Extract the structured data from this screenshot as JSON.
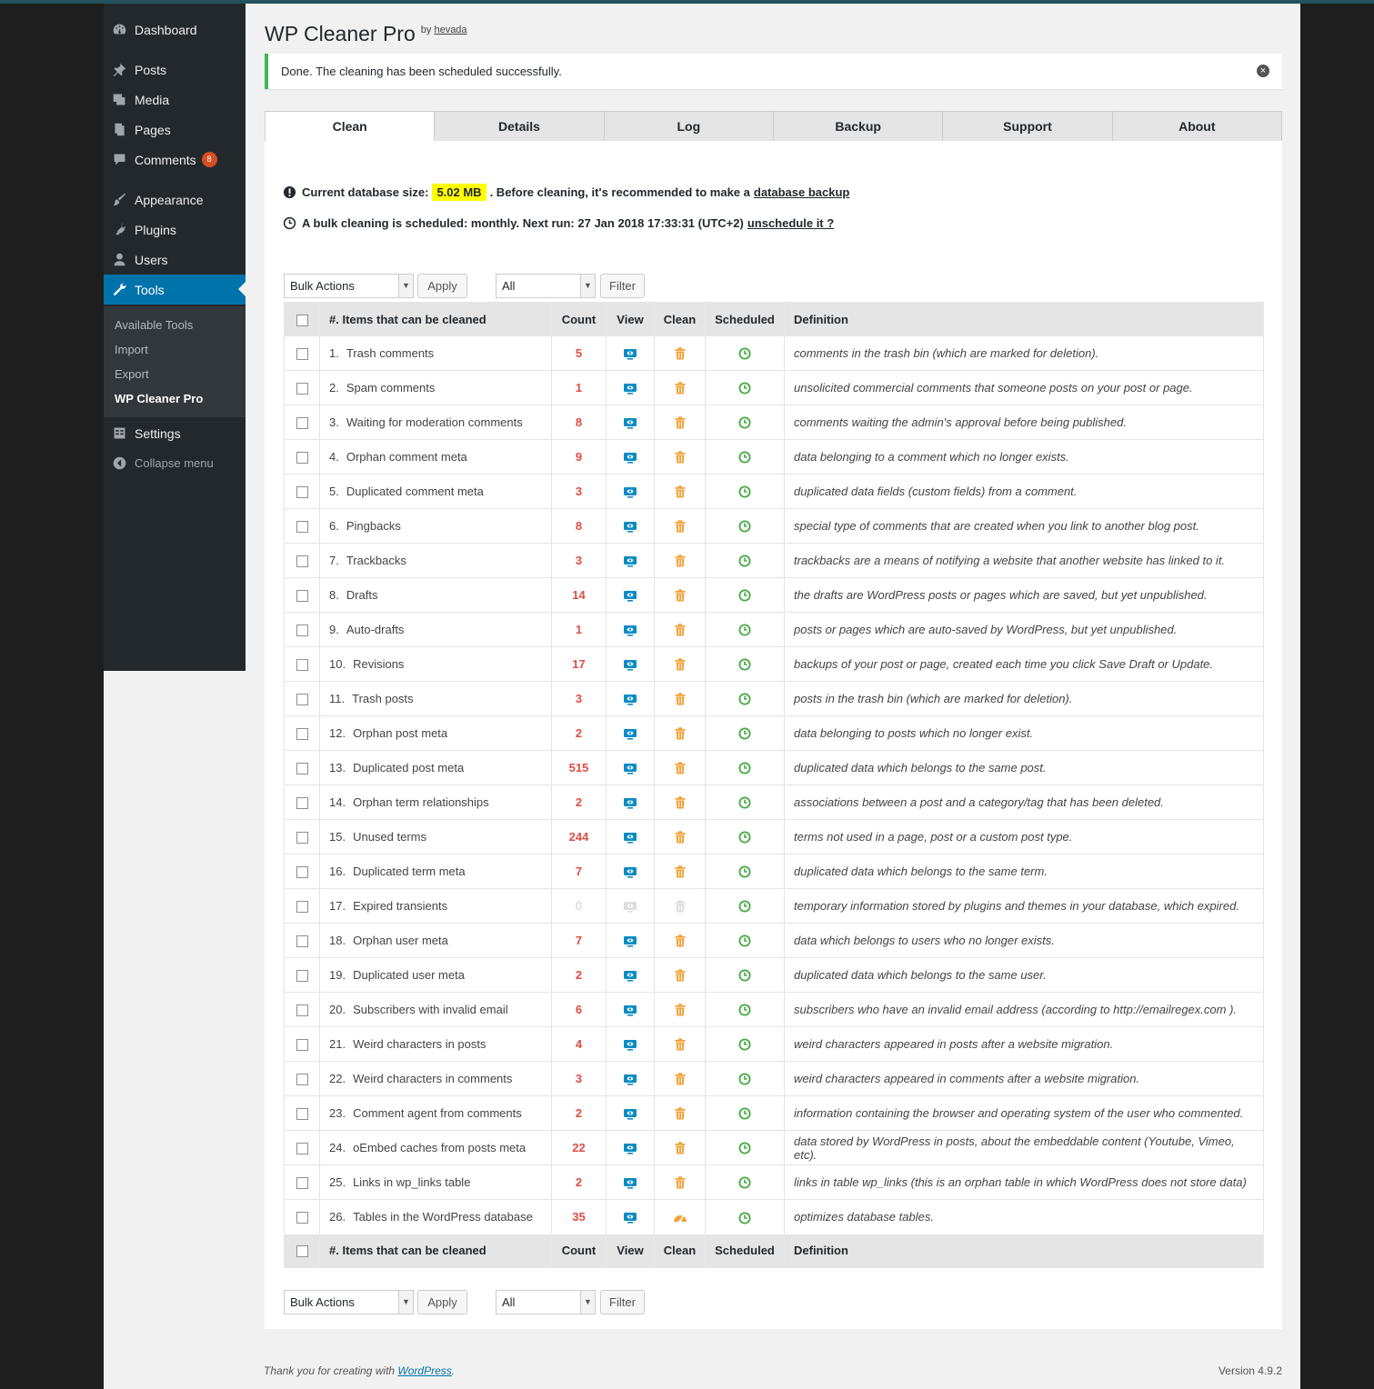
{
  "colors": {
    "sidebar_bg": "#23282d",
    "active_bg": "#0073aa",
    "notice_border": "#46b450",
    "count_red": "#e14d43",
    "view_blue": "#0c8cc4",
    "clean_orange": "#f3a33a",
    "scheduled_green": "#46a846",
    "highlight": "#ffff00"
  },
  "sidebar": {
    "items": [
      {
        "label": "Dashboard",
        "icon": "dashboard-icon"
      },
      {
        "label": "Posts",
        "icon": "pushpin-icon"
      },
      {
        "label": "Media",
        "icon": "media-icon"
      },
      {
        "label": "Pages",
        "icon": "pages-icon"
      },
      {
        "label": "Comments",
        "icon": "comment-icon",
        "badge": "8"
      },
      {
        "label": "Appearance",
        "icon": "paintbrush-icon"
      },
      {
        "label": "Plugins",
        "icon": "plugin-icon"
      },
      {
        "label": "Users",
        "icon": "user-icon"
      },
      {
        "label": "Tools",
        "icon": "wrench-icon",
        "active": true
      },
      {
        "label": "Settings",
        "icon": "settings-icon"
      },
      {
        "label": "Collapse menu",
        "icon": "collapse-icon"
      }
    ],
    "submenu": [
      "Available Tools",
      "Import",
      "Export",
      "WP Cleaner Pro"
    ]
  },
  "page": {
    "title": "WP Cleaner Pro",
    "by": "by",
    "author": "hevada"
  },
  "notice": {
    "text": "Done. The cleaning has been scheduled successfully."
  },
  "tabs": [
    "Clean",
    "Details",
    "Log",
    "Backup",
    "Support",
    "About"
  ],
  "info": {
    "db_size_label": "Current database size:",
    "db_size": "5.02 MB",
    "db_advice": ". Before cleaning, it's recommended to make a",
    "db_backup_link": "database backup",
    "schedule_text": "A bulk cleaning is scheduled: monthly. Next run: 27 Jan 2018 17:33:31 (UTC+2)",
    "unschedule_link": "unschedule it ?"
  },
  "controls": {
    "bulk_actions": "Bulk Actions",
    "apply": "Apply",
    "filter_value": "All",
    "filter": "Filter"
  },
  "table": {
    "headers": [
      "#. Items that can be cleaned",
      "Count",
      "View",
      "Clean",
      "Scheduled",
      "Definition"
    ],
    "rows": [
      {
        "n": "1.",
        "name": "Trash comments",
        "count": "5",
        "def": "comments in the trash bin (which are marked for deletion)."
      },
      {
        "n": "2.",
        "name": "Spam comments",
        "count": "1",
        "def": "unsolicited commercial comments that someone posts on your post or page."
      },
      {
        "n": "3.",
        "name": "Waiting for moderation comments",
        "count": "8",
        "def": "comments waiting the admin's approval before being published."
      },
      {
        "n": "4.",
        "name": "Orphan comment meta",
        "count": "9",
        "def": "data belonging to a comment which no longer exists."
      },
      {
        "n": "5.",
        "name": "Duplicated comment meta",
        "count": "3",
        "def": "duplicated data fields (custom fields) from a comment."
      },
      {
        "n": "6.",
        "name": "Pingbacks",
        "count": "8",
        "def": "special type of comments that are created when you link to another blog post."
      },
      {
        "n": "7.",
        "name": "Trackbacks",
        "count": "3",
        "def": "trackbacks are a means of notifying a website that another website has linked to it."
      },
      {
        "n": "8.",
        "name": "Drafts",
        "count": "14",
        "def": "the drafts are WordPress posts or pages which are saved, but yet unpublished."
      },
      {
        "n": "9.",
        "name": "Auto-drafts",
        "count": "1",
        "def": "posts or pages which are auto-saved by WordPress, but yet unpublished."
      },
      {
        "n": "10.",
        "name": "Revisions",
        "count": "17",
        "def": "backups of your post or page, created each time you click Save Draft or Update."
      },
      {
        "n": "11.",
        "name": "Trash posts",
        "count": "3",
        "def": "posts in the trash bin (which are marked for deletion)."
      },
      {
        "n": "12.",
        "name": "Orphan post meta",
        "count": "2",
        "def": "data belonging to posts which no longer exist."
      },
      {
        "n": "13.",
        "name": "Duplicated post meta",
        "count": "515",
        "def": "duplicated data which belongs to the same post."
      },
      {
        "n": "14.",
        "name": "Orphan term relationships",
        "count": "2",
        "def": "associations between a post and a category/tag that has been deleted."
      },
      {
        "n": "15.",
        "name": "Unused terms",
        "count": "244",
        "def": "terms not used in a page, post or a custom post type."
      },
      {
        "n": "16.",
        "name": "Duplicated term meta",
        "count": "7",
        "def": "duplicated data which belongs to the same term."
      },
      {
        "n": "17.",
        "name": "Expired transients",
        "count": "0",
        "def": "temporary information stored by plugins and themes in your database, which expired.",
        "disabled": true
      },
      {
        "n": "18.",
        "name": "Orphan user meta",
        "count": "7",
        "def": "data which belongs to users who no longer exists."
      },
      {
        "n": "19.",
        "name": "Duplicated user meta",
        "count": "2",
        "def": "duplicated data which belongs to the same user."
      },
      {
        "n": "20.",
        "name": "Subscribers with invalid email",
        "count": "6",
        "def": "subscribers who have an invalid email address (according to http://emailregex.com )."
      },
      {
        "n": "21.",
        "name": "Weird characters in posts",
        "count": "4",
        "def": "weird characters appeared in posts after a website migration."
      },
      {
        "n": "22.",
        "name": "Weird characters in comments",
        "count": "3",
        "def": "weird characters appeared in comments after a website migration."
      },
      {
        "n": "23.",
        "name": "Comment agent from comments",
        "count": "2",
        "def": "information containing the browser and operating system of the user who commented."
      },
      {
        "n": "24.",
        "name": "oEmbed caches from posts meta",
        "count": "22",
        "def": "data stored by WordPress in posts, about the embeddable content (Youtube, Vimeo, etc)."
      },
      {
        "n": "25.",
        "name": "Links in wp_links table",
        "count": "2",
        "def": "links in table wp_links (this is an orphan table in which WordPress does not store data)"
      },
      {
        "n": "26.",
        "name": "Tables in the WordPress database",
        "count": "35",
        "def": "optimizes database tables.",
        "optimize": true
      }
    ]
  },
  "footer": {
    "thanks": "Thank you for creating with",
    "wp_link": "WordPress",
    "version": "Version 4.9.2"
  }
}
